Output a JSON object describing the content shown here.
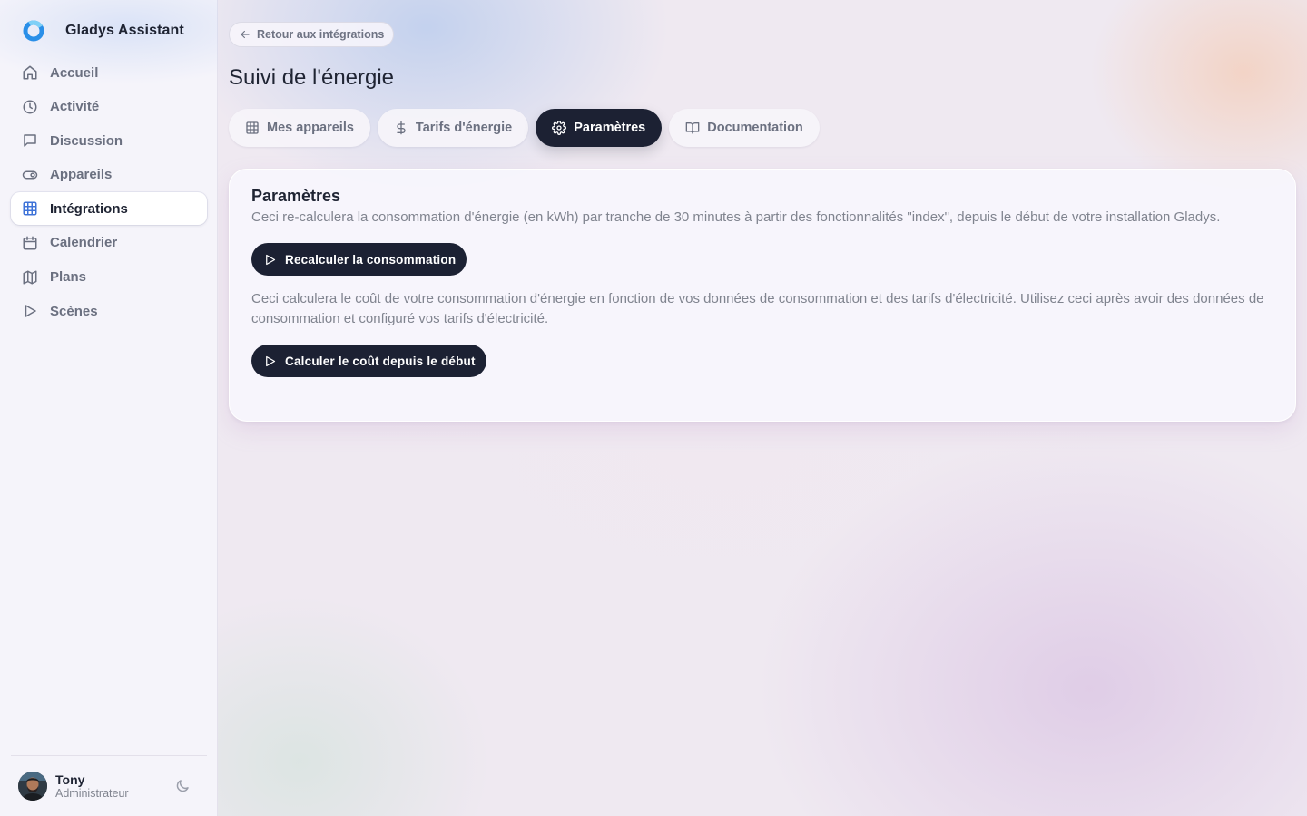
{
  "app": {
    "name": "Gladys Assistant",
    "brand_colors": {
      "ring": "#2a8fe8",
      "accent": "#3e73d8",
      "dark": "#1c2133"
    }
  },
  "sidebar": {
    "items": [
      {
        "label": "Accueil",
        "icon": "home-icon",
        "active": false
      },
      {
        "label": "Activité",
        "icon": "clock-icon",
        "active": false
      },
      {
        "label": "Discussion",
        "icon": "chat-icon",
        "active": false
      },
      {
        "label": "Appareils",
        "icon": "toggle-icon",
        "active": false
      },
      {
        "label": "Intégrations",
        "icon": "grid-icon",
        "active": true
      },
      {
        "label": "Calendrier",
        "icon": "calendar-icon",
        "active": false
      },
      {
        "label": "Plans",
        "icon": "map-icon",
        "active": false
      },
      {
        "label": "Scènes",
        "icon": "play-icon",
        "active": false
      }
    ]
  },
  "user": {
    "name": "Tony",
    "role": "Administrateur"
  },
  "header": {
    "back_label": "Retour aux intégrations",
    "title": "Suivi de l'énergie"
  },
  "tabs": [
    {
      "label": "Mes appareils",
      "icon": "table-icon",
      "active": false
    },
    {
      "label": "Tarifs d'énergie",
      "icon": "dollar-icon",
      "active": false
    },
    {
      "label": "Paramètres",
      "icon": "gear-icon",
      "active": true
    },
    {
      "label": "Documentation",
      "icon": "book-icon",
      "active": false
    }
  ],
  "card": {
    "title": "Paramètres",
    "recalc_text": "Ceci re-calculera la consommation d'énergie (en kWh) par tranche de 30 minutes à partir des fonctionnalités \"index\", depuis le début de votre installation Gladys.",
    "recalc_button": "Recalculer la consommation",
    "cost_text": "Ceci calculera le coût de votre consommation d'énergie en fonction de vos données de consommation et des tarifs d'électricité. Utilisez ceci après avoir des données de consommation et configuré vos tarifs d'électricité.",
    "cost_button": "Calculer le coût depuis le début"
  }
}
